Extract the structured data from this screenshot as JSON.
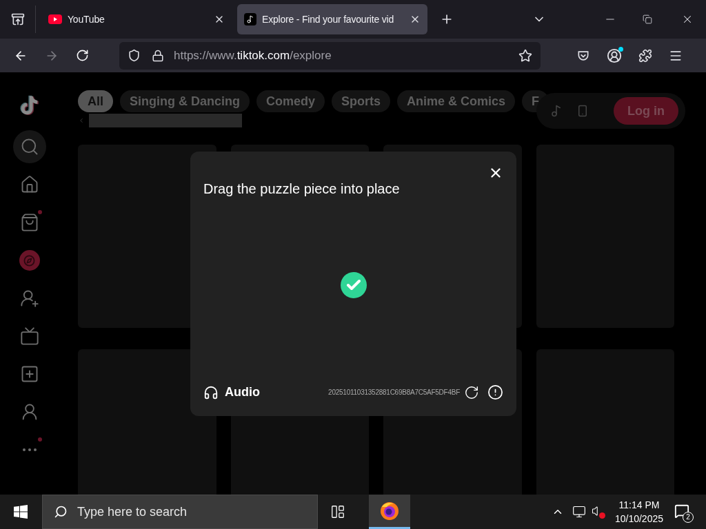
{
  "browser": {
    "tabs": [
      {
        "title": "YouTube",
        "kind": "youtube",
        "selected": false
      },
      {
        "title": "Explore - Find your favourite vid",
        "kind": "tiktok",
        "selected": true
      }
    ],
    "url": {
      "prefix": "https://www.",
      "domain": "tiktok.com",
      "path": "/explore"
    }
  },
  "sidebar": {
    "items": [
      {
        "kind": "search",
        "selected": false,
        "badge": false
      },
      {
        "kind": "home",
        "selected": false,
        "badge": false
      },
      {
        "kind": "shop",
        "selected": false,
        "badge": true
      },
      {
        "kind": "explore",
        "selected": true,
        "badge": false
      },
      {
        "kind": "following",
        "selected": false,
        "badge": false
      },
      {
        "kind": "live",
        "selected": false,
        "badge": false
      },
      {
        "kind": "upload",
        "selected": false,
        "badge": false
      },
      {
        "kind": "profile",
        "selected": false,
        "badge": false
      },
      {
        "kind": "more",
        "selected": false,
        "badge": true
      }
    ]
  },
  "categories": [
    {
      "label": "All",
      "selected": true
    },
    {
      "label": "Singing & Dancing",
      "selected": false
    },
    {
      "label": "Comedy",
      "selected": false
    },
    {
      "label": "Sports",
      "selected": false
    },
    {
      "label": "Anime & Comics",
      "selected": false
    },
    {
      "label": "F",
      "selected": false
    }
  ],
  "login_button": "Log in",
  "captcha": {
    "title": "Drag the puzzle piece into place",
    "solved": true,
    "audio_label": "Audio",
    "session_id": "20251011031352881C69B8A7C5AF5DF4BF"
  },
  "taskbar": {
    "search_placeholder": "Type here to search",
    "time": "11:14 PM",
    "date": "10/10/2025",
    "notifications": "2",
    "volume_muted": true
  }
}
